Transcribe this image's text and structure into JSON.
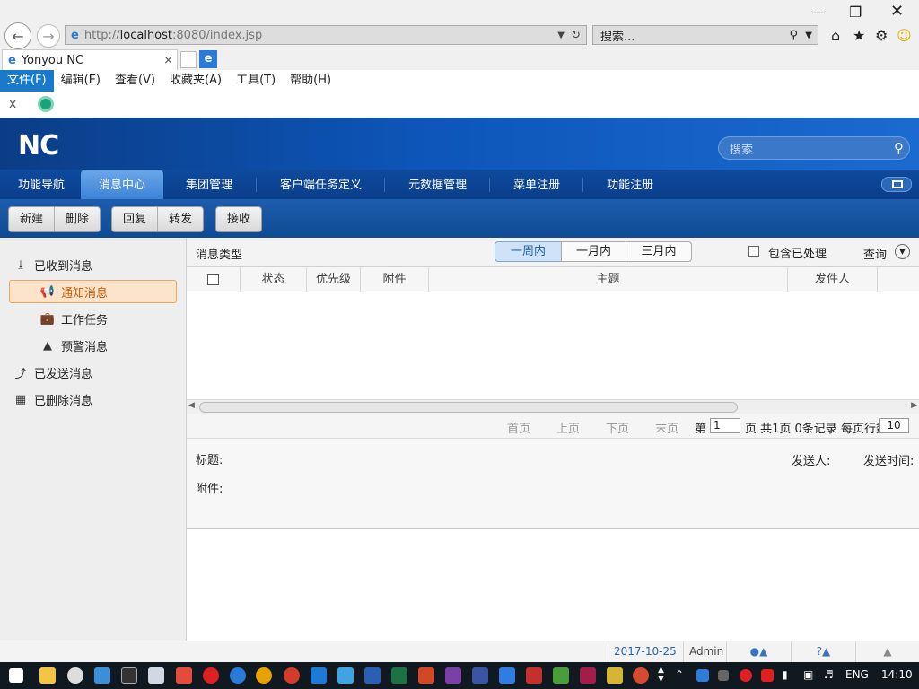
{
  "browser": {
    "url_prefix": "http://",
    "url_host": "localhost",
    "url_rest": ":8080/index.jsp",
    "search_placeholder": "搜索...",
    "tab_title": "Yonyou NC"
  },
  "menubar": [
    "文件(F)",
    "编辑(E)",
    "查看(V)",
    "收藏夹(A)",
    "工具(T)",
    "帮助(H)"
  ],
  "favbar": {
    "close": "x"
  },
  "app": {
    "logo": "NC",
    "search_placeholder": "搜索",
    "nav_tabs": [
      "功能导航",
      "消息中心",
      "集团管理",
      "客户端任务定义",
      "元数据管理",
      "菜单注册",
      "功能注册"
    ],
    "active_tab": "消息中心",
    "toolbar_groups": [
      [
        "新建",
        "删除"
      ],
      [
        "回复",
        "转发"
      ],
      [
        "接收"
      ]
    ]
  },
  "tree": [
    {
      "label": "已收到消息",
      "icon": "inbox-icon"
    },
    {
      "label": "通知消息",
      "icon": "megaphone-icon",
      "selected": true
    },
    {
      "label": "工作任务",
      "icon": "briefcase-icon"
    },
    {
      "label": "预警消息",
      "icon": "alarm-icon"
    },
    {
      "label": "已发送消息",
      "icon": "send-icon"
    },
    {
      "label": "已删除消息",
      "icon": "trash-icon"
    }
  ],
  "filter": {
    "label": "消息类型",
    "periods": [
      "一周内",
      "一月内",
      "三月内"
    ],
    "active_period": "一周内",
    "include_processed": "包含已处理",
    "query": "查询"
  },
  "table": {
    "columns": [
      "状态",
      "优先级",
      "附件",
      "主题",
      "发件人"
    ],
    "rows": []
  },
  "pager": {
    "first": "首页",
    "prev": "上页",
    "next": "下页",
    "last": "末页",
    "page_prefix": "第",
    "page_value": "1",
    "summary": "页 共1页 0条记录 每页行数",
    "page_size": "10"
  },
  "detail": {
    "title_label": "标题:",
    "attach_label": "附件:",
    "sender_label": "发送人:",
    "time_label": "发送时间:"
  },
  "status": {
    "date": "2017-10-25",
    "user": "Admin"
  },
  "taskbar": {
    "lang": "ENG",
    "time": "14:10"
  }
}
